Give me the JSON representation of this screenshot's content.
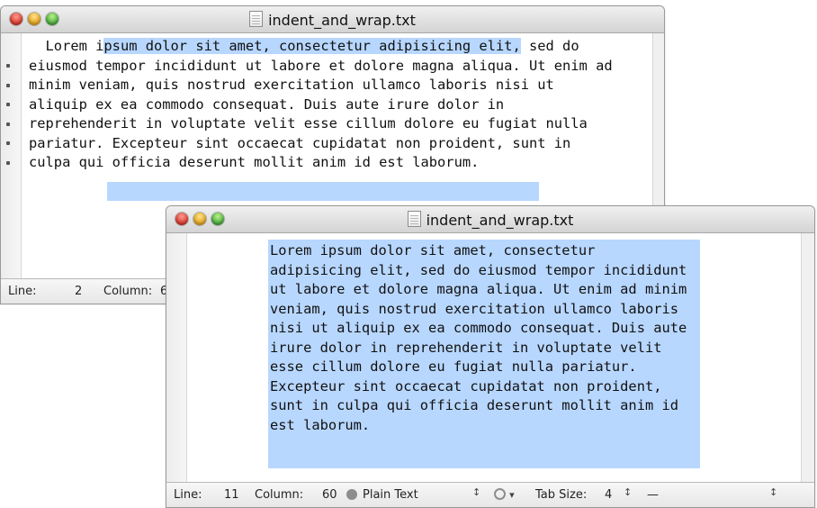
{
  "windows": [
    {
      "title": "indent_and_wrap.txt",
      "lines": [
        {
          "pre": "  Lorem i",
          "sel": "psum dolor sit amet, consectetur adipisicing elit,",
          "post": " sed do"
        },
        {
          "pre": "eiusmod tempor incididunt ut labore et dolore magna aliqua. Ut enim ad",
          "sel": "",
          "post": ""
        },
        {
          "pre": "minim veniam, quis nostrud exercitation ullamco laboris nisi ut",
          "sel": "",
          "post": ""
        },
        {
          "pre": "aliquip ex ea commodo consequat. Duis aute irure dolor in",
          "sel": "",
          "post": ""
        },
        {
          "pre": "reprehenderit in voluptate velit esse cillum dolore eu fugiat nulla",
          "sel": "",
          "post": ""
        },
        {
          "pre": "pariatur. Excepteur sint occaecat cupidatat non proident, sunt in",
          "sel": "",
          "post": ""
        },
        {
          "pre": "culpa qui officia deserunt mollit anim id est laborum.",
          "sel": "",
          "post": ""
        }
      ],
      "status": {
        "line_label": "Line:",
        "line_value": "2",
        "column_label": "Column:",
        "column_value": "6"
      }
    },
    {
      "title": "indent_and_wrap.txt",
      "lines": [
        "Lorem ipsum dolor sit amet, consectetur",
        "adipisicing elit, sed do eiusmod tempor incididunt",
        "ut labore et dolore magna aliqua. Ut enim ad minim",
        "veniam, quis nostrud exercitation ullamco laboris",
        "nisi ut aliquip ex ea commodo consequat. Duis aute",
        "irure dolor in reprehenderit in voluptate velit",
        "esse cillum dolore eu fugiat nulla pariatur.",
        "Excepteur sint occaecat cupidatat non proident,",
        "sunt in culpa qui officia deserunt mollit anim id",
        "est laborum."
      ],
      "status": {
        "line_label": "Line:",
        "line_value": "11",
        "column_label": "Column:",
        "column_value": "60",
        "syntax": "Plain Text",
        "tab_size_label": "Tab Size:",
        "tab_size_value": "4",
        "function_menu": "—"
      }
    }
  ],
  "colors": {
    "selection": "#b8d7ff",
    "close": "#d6372b",
    "minimize": "#e2a119",
    "zoom": "#47a83a"
  },
  "icons": [
    "close-button",
    "minimize-button",
    "zoom-button",
    "document-icon",
    "syntax-clock-icon",
    "gear-icon",
    "stepper-arrows-icon"
  ]
}
